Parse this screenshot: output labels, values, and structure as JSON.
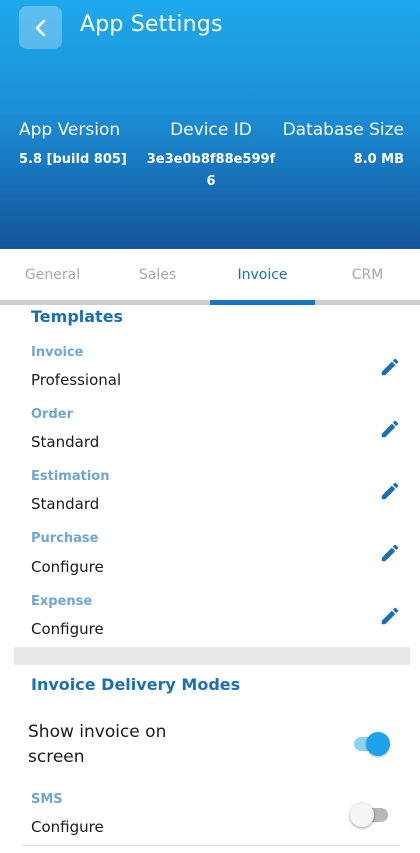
{
  "header": {
    "title": "App Settings",
    "back_icon": "chevron-left-icon",
    "info": [
      {
        "label": "App Version",
        "value": "5.8 [build 805]"
      },
      {
        "label": "Device ID",
        "value": "3e3e0b8f88e599f6"
      },
      {
        "label": "Database Size",
        "value": "8.0 MB"
      }
    ]
  },
  "tabs": [
    {
      "label": "General",
      "active": false
    },
    {
      "label": "Sales",
      "active": false
    },
    {
      "label": "Invoice",
      "active": true
    },
    {
      "label": "CRM",
      "active": false
    }
  ],
  "templates": {
    "title": "Templates",
    "items": [
      {
        "label": "Invoice",
        "value": "Professional"
      },
      {
        "label": "Order",
        "value": "Standard"
      },
      {
        "label": "Estimation",
        "value": "Standard"
      },
      {
        "label": "Purchase",
        "value": "Configure"
      },
      {
        "label": "Expense",
        "value": "Configure"
      }
    ]
  },
  "delivery": {
    "title": "Invoice Delivery Modes",
    "show_on_screen": {
      "label": "Show invoice on screen",
      "enabled": true
    },
    "sms": {
      "label": "SMS",
      "value": "Configure",
      "enabled": false
    }
  },
  "colors": {
    "accent": "#1b6fb3",
    "toggle_on": "#1fa2ee",
    "header_top": "#1ea9ec",
    "header_bottom": "#15549a"
  }
}
